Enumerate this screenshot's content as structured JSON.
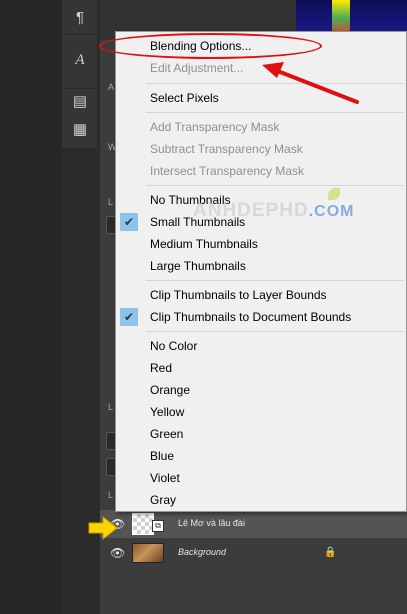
{
  "toolstrip": {
    "tools": [
      {
        "icon": "pilcrow-icon",
        "glyph": "¶"
      },
      {
        "icon": "character-icon",
        "glyph": "A"
      },
      {
        "icon": "panel-icon",
        "glyph": "▤"
      },
      {
        "icon": "properties-icon",
        "glyph": "▦"
      }
    ]
  },
  "panel_peek": {
    "letters": [
      "A",
      "W",
      "L",
      "L",
      "L",
      "L"
    ]
  },
  "menu": {
    "items": [
      {
        "label": "Blending Options...",
        "enabled": true,
        "checked": false
      },
      {
        "label": "Edit Adjustment...",
        "enabled": false,
        "checked": false
      },
      {
        "label": "Select Pixels",
        "enabled": true,
        "checked": false
      },
      {
        "label": "Add Transparency Mask",
        "enabled": false,
        "checked": false
      },
      {
        "label": "Subtract Transparency Mask",
        "enabled": false,
        "checked": false
      },
      {
        "label": "Intersect Transparency Mask",
        "enabled": false,
        "checked": false
      },
      {
        "label": "No Thumbnails",
        "enabled": true,
        "checked": false
      },
      {
        "label": "Small Thumbnails",
        "enabled": true,
        "checked": true
      },
      {
        "label": "Medium Thumbnails",
        "enabled": true,
        "checked": false
      },
      {
        "label": "Large Thumbnails",
        "enabled": true,
        "checked": false
      },
      {
        "label": "Clip Thumbnails to Layer Bounds",
        "enabled": true,
        "checked": false
      },
      {
        "label": "Clip Thumbnails to Document Bounds",
        "enabled": true,
        "checked": true
      },
      {
        "label": "No Color",
        "enabled": true,
        "checked": false
      },
      {
        "label": "Red",
        "enabled": true,
        "checked": false
      },
      {
        "label": "Orange",
        "enabled": true,
        "checked": false
      },
      {
        "label": "Yellow",
        "enabled": true,
        "checked": false
      },
      {
        "label": "Green",
        "enabled": true,
        "checked": false
      },
      {
        "label": "Blue",
        "enabled": true,
        "checked": false
      },
      {
        "label": "Violet",
        "enabled": true,
        "checked": false
      },
      {
        "label": "Gray",
        "enabled": true,
        "checked": false
      }
    ],
    "checkmark": "✔"
  },
  "layers": [
    {
      "name": "Lê Mơ và lâu đài",
      "selected": true,
      "locked": false
    },
    {
      "name": "Background",
      "selected": false,
      "locked": true
    }
  ],
  "watermark": {
    "main": "ANHDEPHD",
    "suffix": ".COM"
  },
  "annotation": {
    "highlight_color": "#e01010",
    "pointer_color": "#ffd400"
  }
}
